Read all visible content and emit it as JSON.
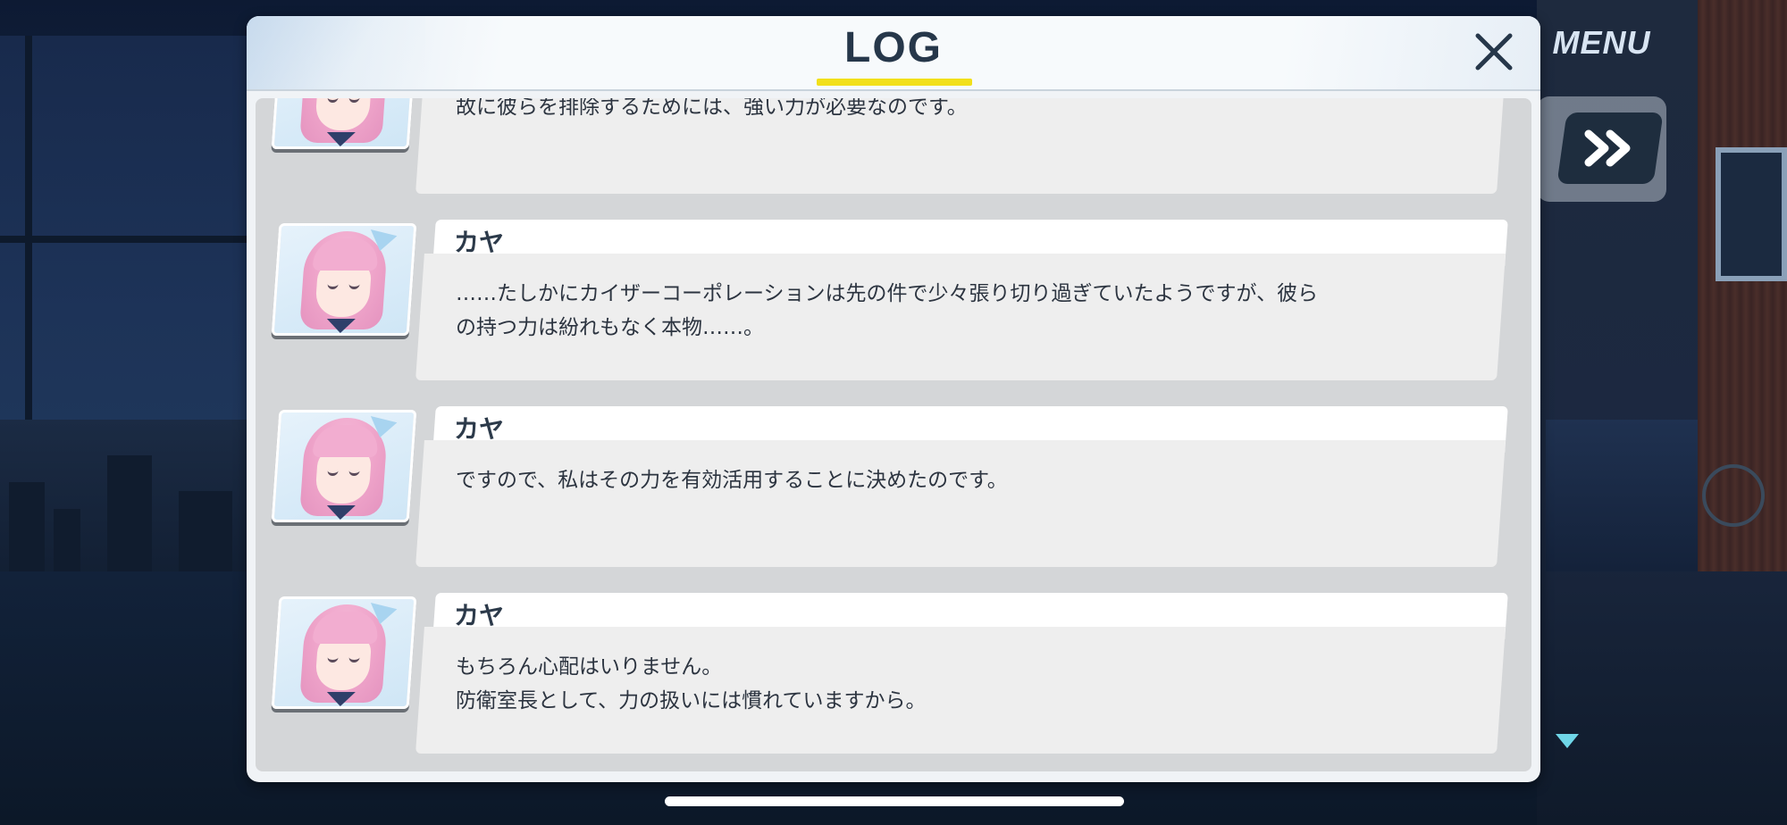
{
  "header": {
    "title": "LOG",
    "close_icon": "close-icon"
  },
  "hud": {
    "menu_label": "MENU",
    "fast_forward_icon": "fast-forward-icon",
    "scroll_down_icon": "scroll-down-arrow-icon"
  },
  "colors": {
    "title_underline": "#f2e01a",
    "scroll_arrow": "#6fd6e8",
    "panel_bg": "#f0f3f6",
    "title_text": "#26374a"
  },
  "log": {
    "entries": [
      {
        "speaker": "",
        "text": "故に彼らを排除するためには、強い力が必要なのです。",
        "avatar": "kaya-portrait"
      },
      {
        "speaker": "カヤ",
        "text": "……たしかにカイザーコーポレーションは先の件で少々張り切り過ぎていたようですが、彼ら\nの持つ力は紛れもなく本物……。",
        "avatar": "kaya-portrait"
      },
      {
        "speaker": "カヤ",
        "text": "ですので、私はその力を有効活用することに決めたのです。",
        "avatar": "kaya-portrait"
      },
      {
        "speaker": "カヤ",
        "text": "もちろん心配はいりません。\n防衛室長として、力の扱いには慣れていますから。",
        "avatar": "kaya-portrait"
      }
    ]
  }
}
